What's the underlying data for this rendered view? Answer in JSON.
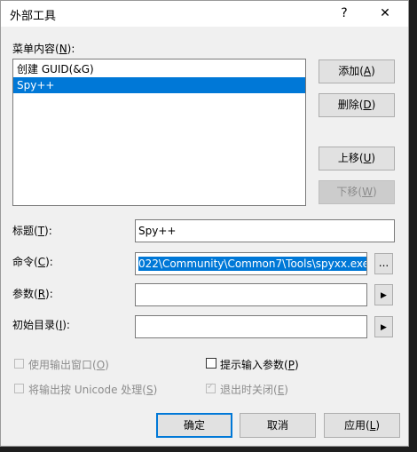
{
  "window": {
    "title": "外部工具",
    "help_glyph": "?",
    "close_glyph": "✕"
  },
  "menu_contents": {
    "label_prefix": "菜单内容(",
    "label_key": "N",
    "label_suffix": "):",
    "items": [
      {
        "label": "创建 GUID(&G)",
        "selected": false
      },
      {
        "label": "Spy++",
        "selected": true
      }
    ]
  },
  "buttons": {
    "add": {
      "prefix": "添加(",
      "key": "A",
      "suffix": ")"
    },
    "delete": {
      "prefix": "删除(",
      "key": "D",
      "suffix": ")"
    },
    "move_up": {
      "prefix": "上移(",
      "key": "U",
      "suffix": ")"
    },
    "move_down": {
      "prefix": "下移(",
      "key": "W",
      "suffix": ")"
    },
    "ok": "确定",
    "cancel": "取消",
    "apply": {
      "prefix": "应用(",
      "key": "L",
      "suffix": ")"
    }
  },
  "fields": {
    "title": {
      "prefix": "标题(",
      "key": "T",
      "suffix": "):",
      "value": "Spy++"
    },
    "command": {
      "prefix": "命令(",
      "key": "C",
      "suffix": "):",
      "value": "022\\Community\\Common7\\Tools\\spyxx.exe",
      "browse_label": "..."
    },
    "arguments": {
      "prefix": "参数(",
      "key": "R",
      "suffix": "):",
      "value": "",
      "menu_glyph": "▶"
    },
    "initial_dir": {
      "prefix": "初始目录(",
      "key": "I",
      "suffix": "):",
      "value": "",
      "menu_glyph": "▶"
    }
  },
  "checkboxes": {
    "use_output_window": {
      "prefix": "使用输出窗口(",
      "key": "O",
      "suffix": ")",
      "checked": false,
      "enabled": false
    },
    "prompt_arguments": {
      "prefix": "提示输入参数(",
      "key": "P",
      "suffix": ")",
      "checked": false,
      "enabled": true
    },
    "unicode_output": {
      "prefix": "将输出按 Unicode 处理(",
      "key": "S",
      "suffix": ")",
      "checked": false,
      "enabled": false
    },
    "close_on_exit": {
      "prefix": "退出时关闭(",
      "key": "E",
      "suffix": ")",
      "checked": true,
      "enabled": false,
      "check_glyph": "✓"
    }
  }
}
